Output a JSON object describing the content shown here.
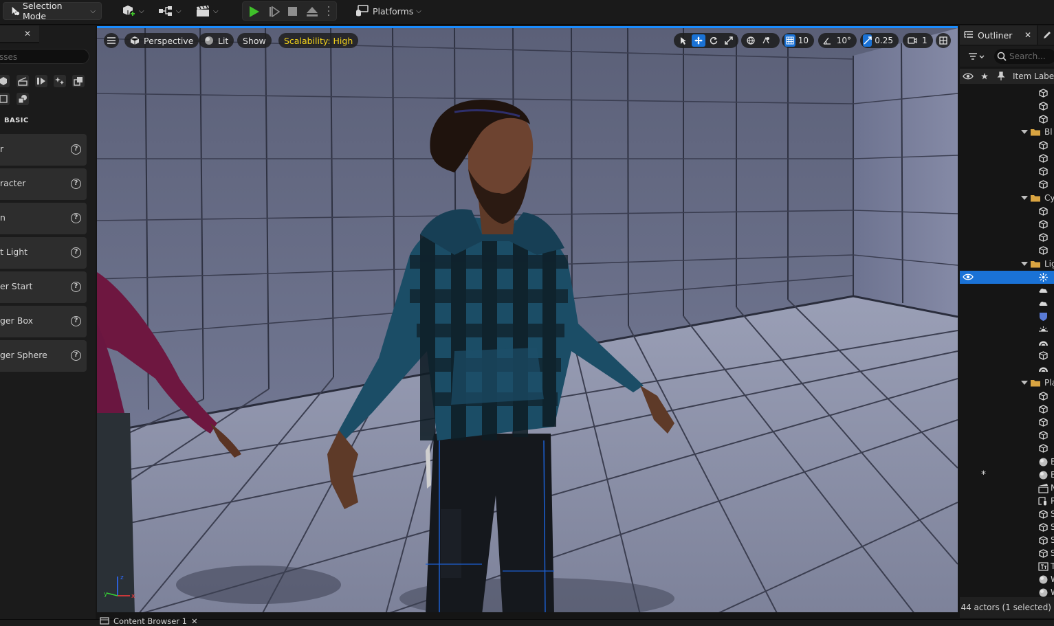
{
  "toolbar": {
    "selection_mode": "Selection Mode",
    "platforms": "Platforms"
  },
  "left_panel": {
    "search_placeholder": "sses",
    "category": "BASIC",
    "items": [
      {
        "label": "r"
      },
      {
        "label": "racter"
      },
      {
        "label": "n"
      },
      {
        "label": "t Light"
      },
      {
        "label": "er Start"
      },
      {
        "label": "ger Box"
      },
      {
        "label": "ger Sphere"
      }
    ]
  },
  "viewport": {
    "perspective": "Perspective",
    "lit": "Lit",
    "show": "Show",
    "scalability": "Scalability: High",
    "grid_snap": "10",
    "rotation_snap": "10°",
    "scale_snap": "0.25",
    "camera_speed": "1"
  },
  "outliner": {
    "title": "Outliner",
    "search_placeholder": "Search...",
    "column_label": "Item Label",
    "folders": [
      "Bl",
      "Cy",
      "Lig",
      "Pla"
    ],
    "items": [
      "BP",
      "BP",
      "Ne",
      "Pla",
      "SM",
      "SM",
      "SM",
      "SM",
      "Te",
      "Wo",
      "Wo"
    ],
    "footer": "44 actors (1 selected)"
  },
  "bottom": {
    "content_browser": "Content Browser 1"
  },
  "colors": {
    "accent": "#1a72d6",
    "play": "#3fbf2a",
    "scalability": "#f2d21a"
  }
}
